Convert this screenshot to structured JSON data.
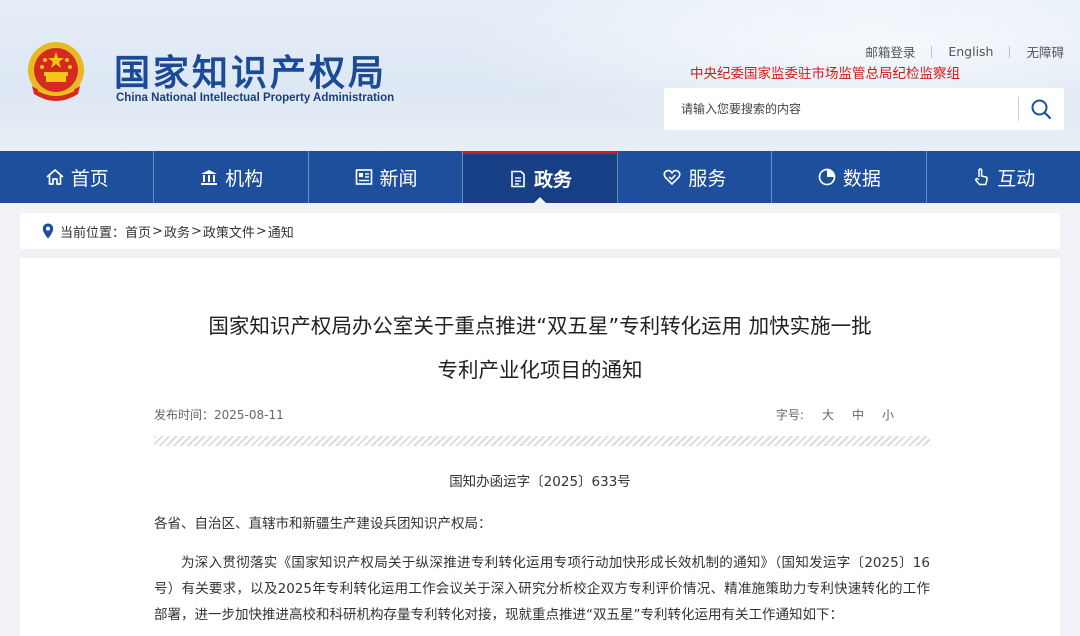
{
  "header": {
    "site_name_cn": "国家知识产权局",
    "site_name_en": "China National Intellectual Property Administration",
    "top_links": [
      "邮箱登录",
      "English",
      "无障碍"
    ],
    "discipline_link": "中央纪委国家监委驻市场监管总局纪检监察组",
    "search_placeholder": "请输入您要搜索的内容"
  },
  "nav": {
    "items": [
      {
        "label": "首页",
        "icon": "home-icon"
      },
      {
        "label": "机构",
        "icon": "institution-icon"
      },
      {
        "label": "新闻",
        "icon": "news-icon"
      },
      {
        "label": "政务",
        "icon": "government-affairs-icon",
        "active": true
      },
      {
        "label": "服务",
        "icon": "service-icon"
      },
      {
        "label": "数据",
        "icon": "pie-chart-icon"
      },
      {
        "label": "互动",
        "icon": "interaction-hand-icon"
      }
    ]
  },
  "breadcrumb": {
    "prefix": "当前位置：",
    "items": [
      "首页",
      "政务",
      "政策文件",
      "通知"
    ],
    "separator": ">"
  },
  "article": {
    "title_line1": "国家知识产权局办公室关于重点推进“双五星”专利转化运用 加快实施一批",
    "title_line2": "专利产业化项目的通知",
    "publish_label": "发布时间：",
    "publish_date": "2025-08-11",
    "fontsize_label": "字号:",
    "fontsize_options": [
      "大",
      "中",
      "小"
    ],
    "doc_number": "国知办函运字〔2025〕633号",
    "addressee": "各省、自治区、直辖市和新疆生产建设兵团知识产权局：",
    "paragraph1": "为深入贯彻落实《国家知识产权局关于纵深推进专利转化运用专项行动加快形成长效机制的通知》（国知发运字〔2025〕16号）有关要求，以及2025年专利转化运用工作会议关于深入研究分析校企双方专利评价情况、精准施策助力专利快速转化的工作部署，进一步加快推进高校和科研机构存量专利转化对接，现就重点推进“双五星”专利转化运用有关工作通知如下："
  },
  "colors": {
    "nav_bg": "#1e4f9c",
    "nav_active_bg": "#163f86",
    "nav_active_top": "#c91f25",
    "brand_blue": "#1b4a97",
    "discipline_red": "#d21a1a"
  }
}
